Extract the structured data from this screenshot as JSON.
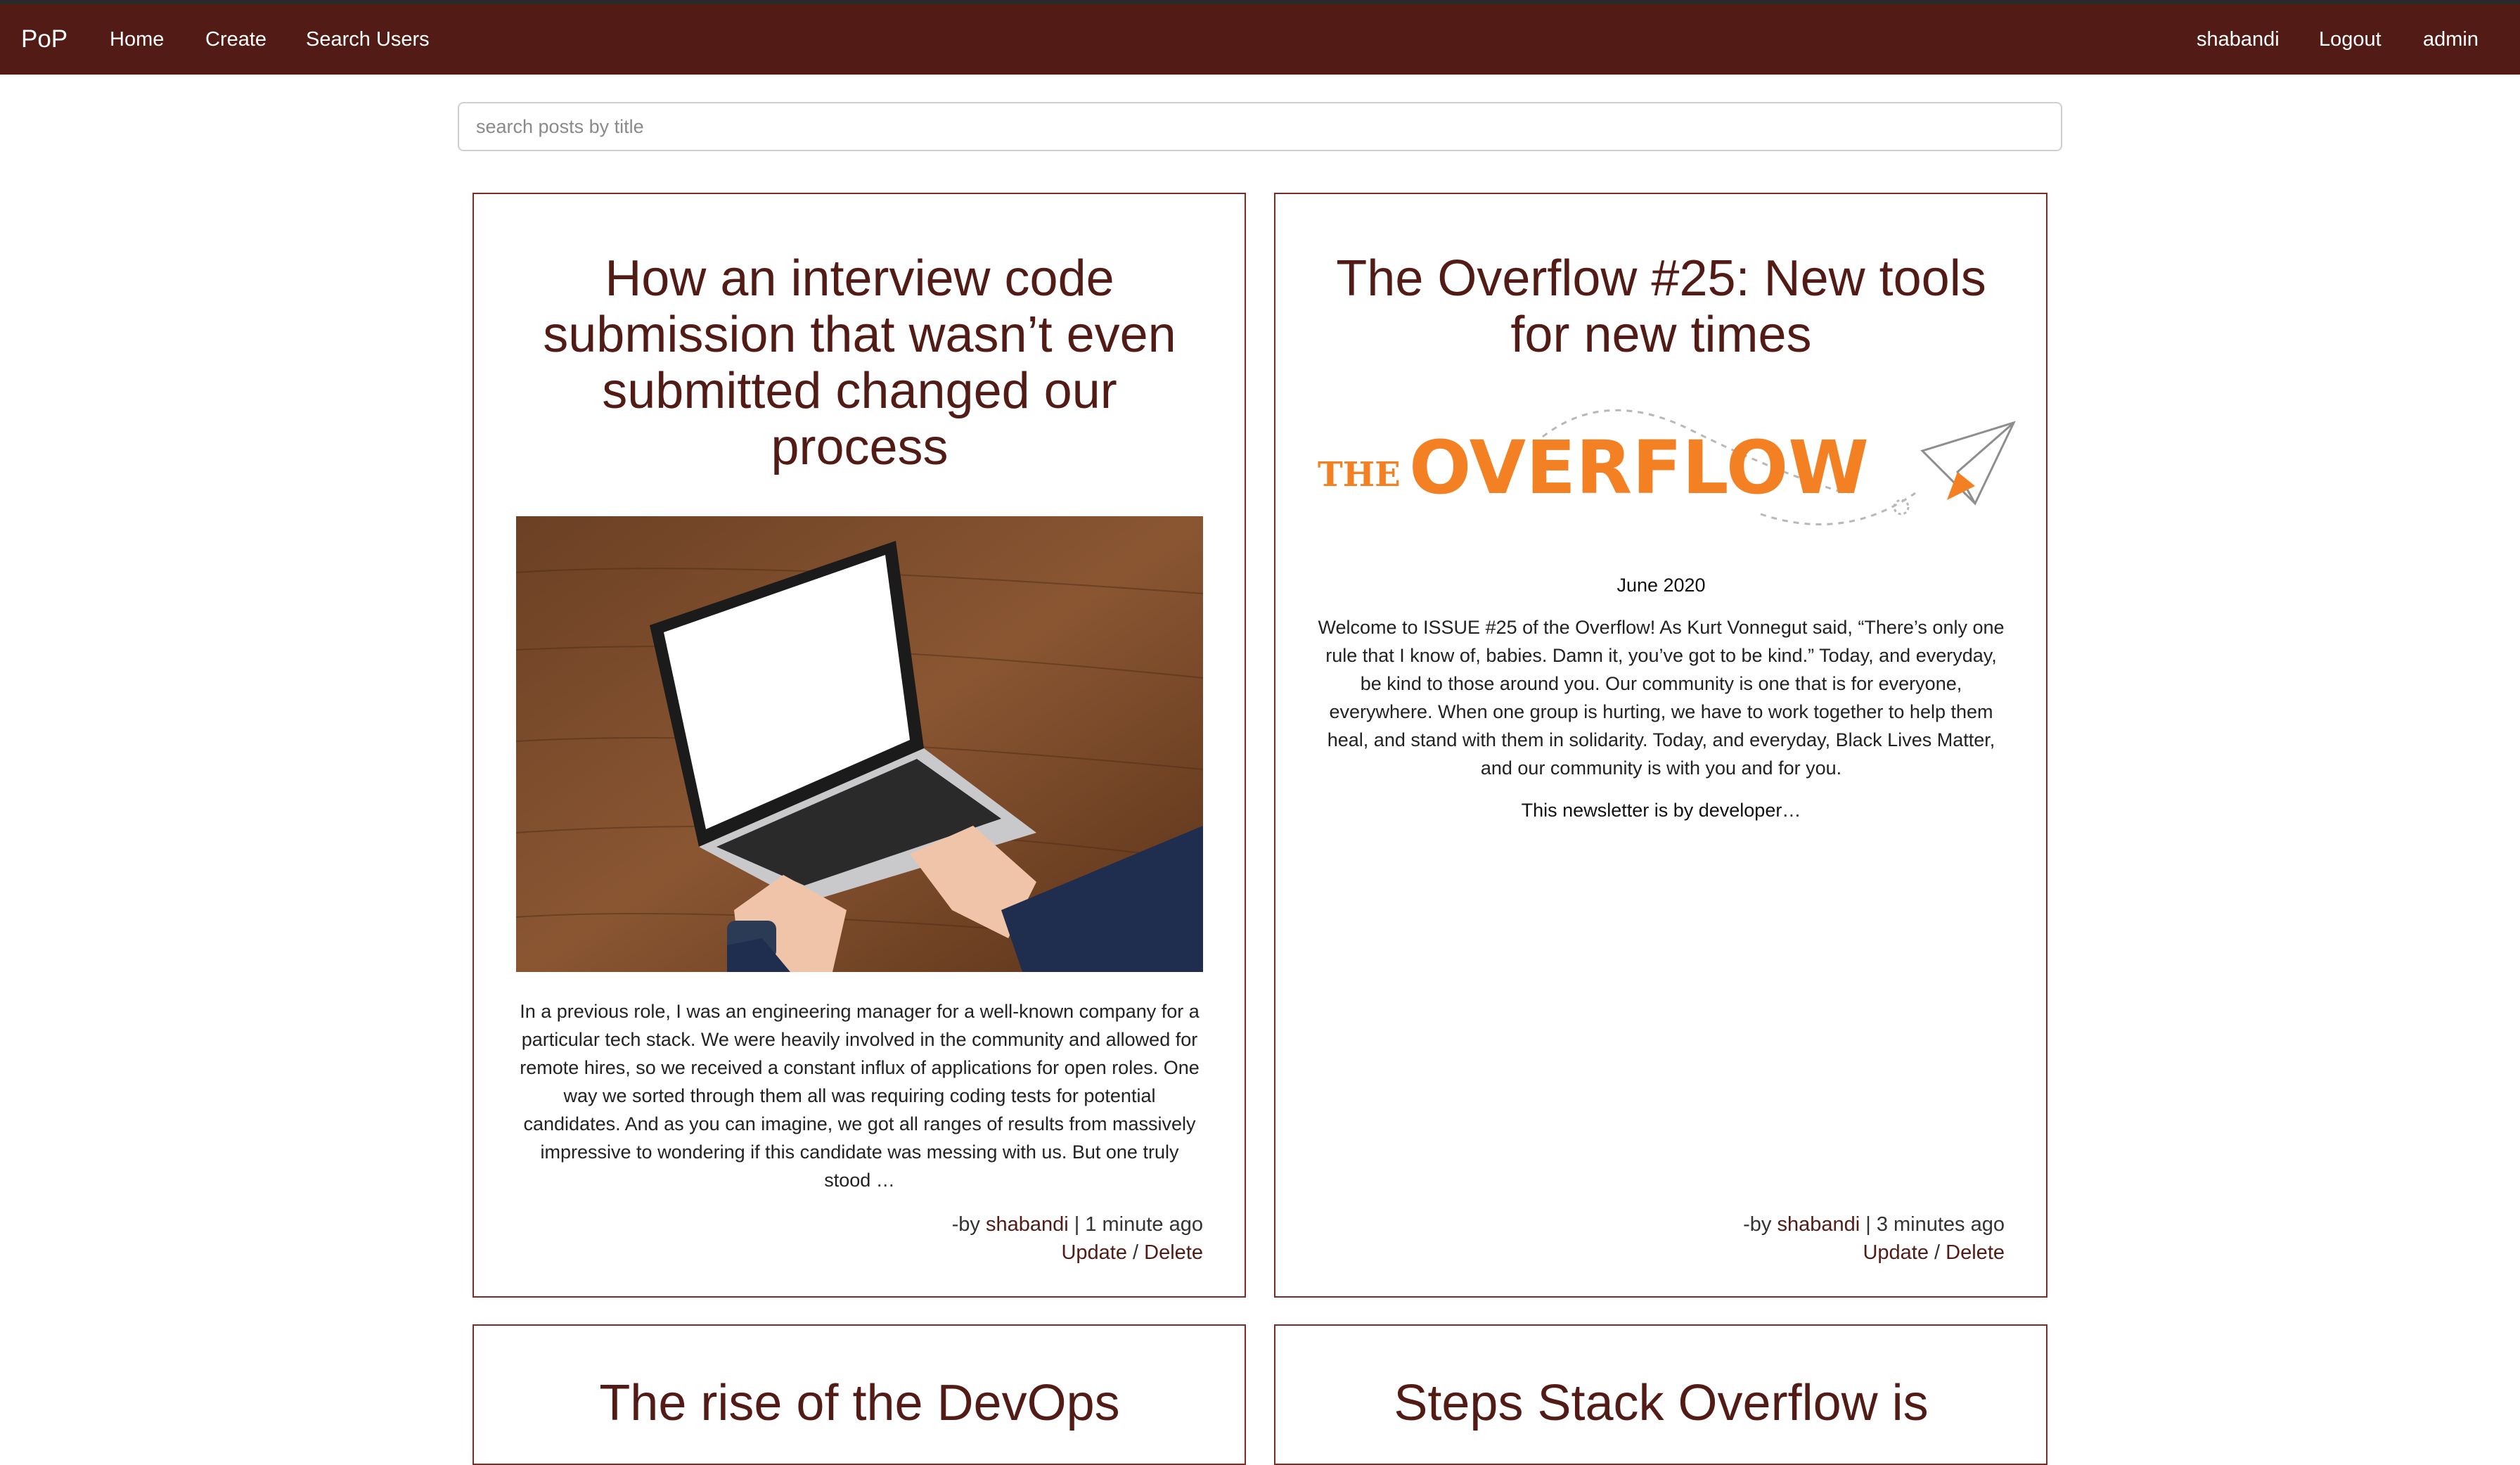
{
  "nav": {
    "brand": "PoP",
    "home": "Home",
    "create": "Create",
    "search_users": "Search Users",
    "username": "shabandi",
    "logout": "Logout",
    "admin": "admin"
  },
  "search": {
    "placeholder": "search posts by title",
    "value": ""
  },
  "posts": [
    {
      "title": "How an interview code submission that wasn’t even submitted changed our process",
      "image": "laptop-on-wooden-desk",
      "body": "In a previous role, I was an engineering manager for a well-known company for a particular tech stack. We were heavily involved in the community and allowed for remote hires, so we received a constant influx of applications for open roles. One way we sorted through them all was requiring coding tests for potential candidates. And as you can imagine, we got all ranges of results from massively impressive to wondering if this candidate was messing with us. But one truly stood …",
      "by_prefix": "-by",
      "author": "shabandi",
      "separator": "|",
      "time": "1 minute ago",
      "update": "Update",
      "slash": "/",
      "delete": "Delete"
    },
    {
      "title": "The Overflow #25: New tools for new times",
      "logo_the": "THE",
      "logo_overflow": "OVERFLOW",
      "date": "June 2020",
      "body": "Welcome to ISSUE #25 of the Overflow! As Kurt Vonnegut said, “There’s only one rule that I know of, babies. Damn it, you’ve got to be kind.” Today, and everyday, be kind to those around you. Our community is one that is for everyone, everywhere. When one group is hurting, we have to work together to help them heal, and stand with them in solidarity. Today, and everyday, Black Lives Matter, and our community is with you and for you.",
      "body2": "This newsletter is by developer…",
      "by_prefix": "-by",
      "author": "shabandi",
      "separator": "|",
      "time": "3 minutes ago",
      "update": "Update",
      "slash": "/",
      "delete": "Delete"
    },
    {
      "title": "The rise of the DevOps"
    },
    {
      "title": "Steps Stack Overflow is"
    }
  ],
  "colors": {
    "nav_bg": "#521b16",
    "accent": "#521b16",
    "card_border": "#7a2e26",
    "logo_orange": "#f48024"
  }
}
